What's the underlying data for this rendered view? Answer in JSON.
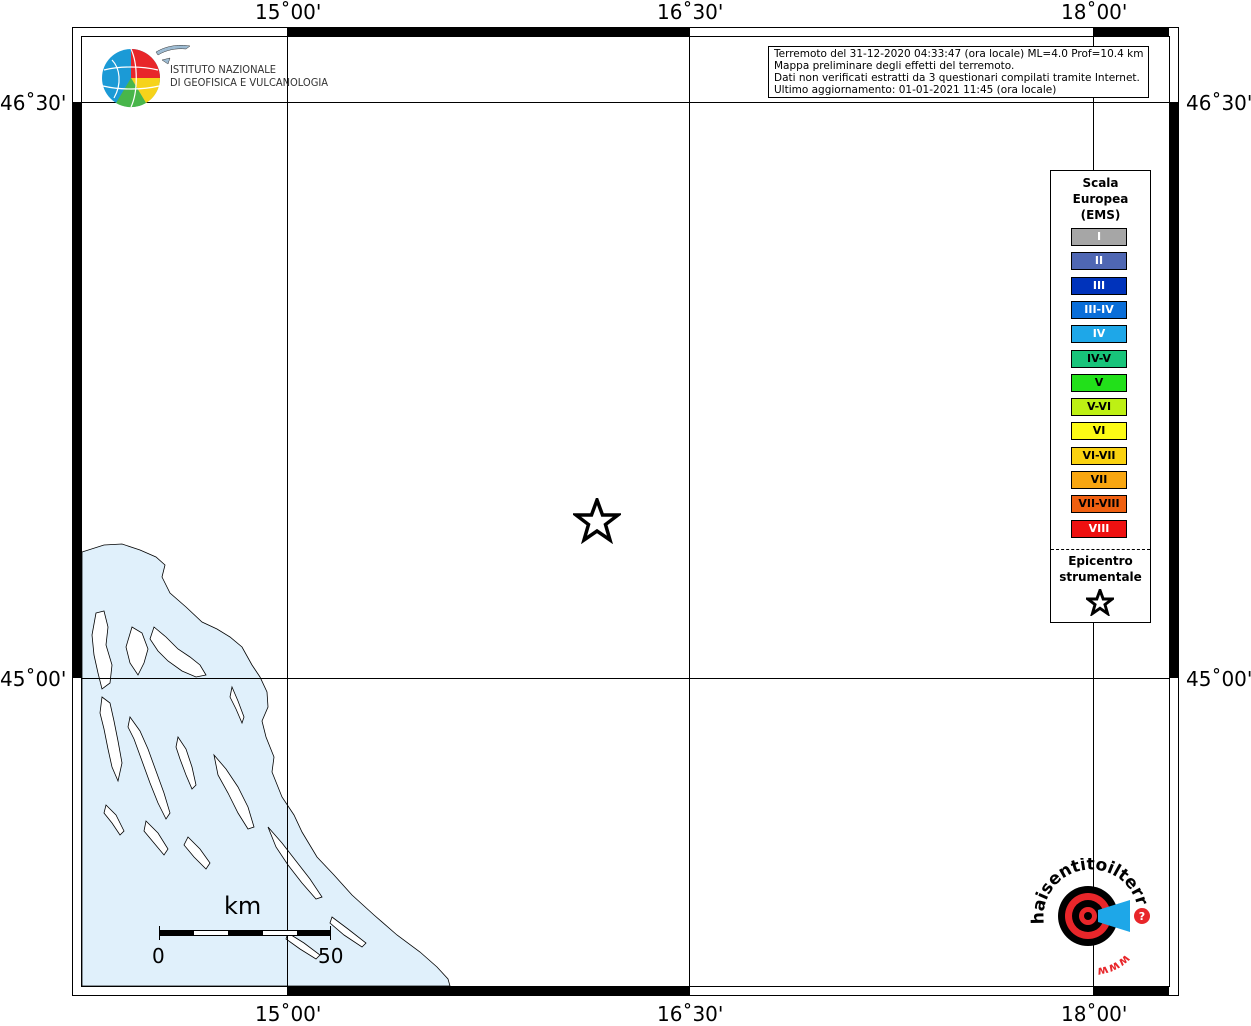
{
  "logo": {
    "line1": "ISTITUTO NAZIONALE",
    "line2": "DI GEOFISICA E VULCANOLOGIA"
  },
  "info": {
    "line1": "Terremoto del 31-12-2020 04:33:47 (ora locale) ML=4.0 Prof=10.4 km",
    "line2": "Mappa preliminare degli effetti del terremoto.",
    "line3": "Dati non verificati estratti da 3 questionari compilati tramite Internet.",
    "line4": "Ultimo aggiornamento: 01-01-2021 11:45 (ora locale)"
  },
  "coords": {
    "lon_15": "15˚00'",
    "lon_1630": "16˚30'",
    "lon_18": "18˚00'",
    "lat_4630": "46˚30'",
    "lat_45": "45˚00'"
  },
  "legend": {
    "title1": "Scala",
    "title2": "Europea",
    "title3": "(EMS)",
    "items": [
      {
        "label": "I",
        "color": "#a6a6a6",
        "text_color": "#ffffff"
      },
      {
        "label": "II",
        "color": "#4f67b3",
        "text_color": "#ffffff"
      },
      {
        "label": "III",
        "color": "#0033bb",
        "text_color": "#ffffff"
      },
      {
        "label": "III-IV",
        "color": "#0a6ed8",
        "text_color": "#ffffff"
      },
      {
        "label": "IV",
        "color": "#1ea7e8",
        "text_color": "#ffffff"
      },
      {
        "label": "IV-V",
        "color": "#18c47a",
        "text_color": "#000000"
      },
      {
        "label": "V",
        "color": "#22e01a",
        "text_color": "#000000"
      },
      {
        "label": "V-VI",
        "color": "#bdf014",
        "text_color": "#000000"
      },
      {
        "label": "VI",
        "color": "#fcfb15",
        "text_color": "#000000"
      },
      {
        "label": "VI-VII",
        "color": "#fad210",
        "text_color": "#000000"
      },
      {
        "label": "VII",
        "color": "#f8a610",
        "text_color": "#000000"
      },
      {
        "label": "VII-VIII",
        "color": "#f06010",
        "text_color": "#000000"
      },
      {
        "label": "VIII",
        "color": "#ee1111",
        "text_color": "#ffffff"
      }
    ],
    "epi1": "Epicentro",
    "epi2": "strumentale"
  },
  "scalebar": {
    "unit": "km",
    "start": "0",
    "end": "50"
  },
  "hst_logo": {
    "text": "haisentitoilterremoto.it",
    "www": "www."
  },
  "colors": {
    "sea": "#e0f0fb",
    "land": "#ffffff",
    "coast": "#000000"
  }
}
